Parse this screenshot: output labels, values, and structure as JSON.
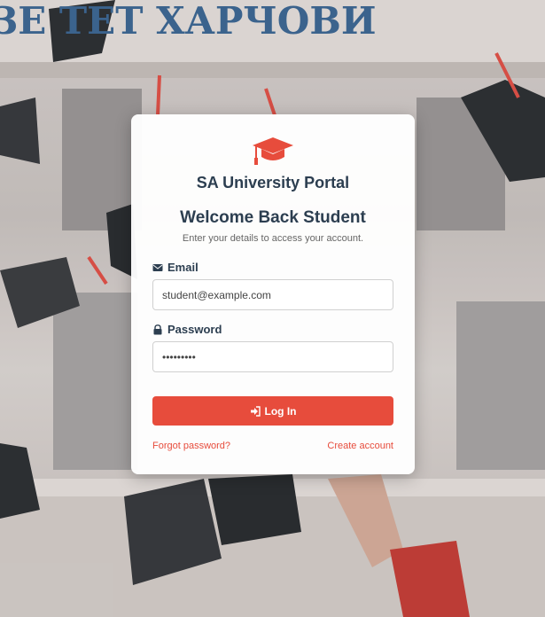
{
  "background": {
    "sign_text": "ЗЕ ТЕТ ХАРЧОВИ"
  },
  "brand": {
    "logo_icon": "graduation-cap-icon",
    "title": "SA University Portal",
    "accent": "#e74c3c",
    "text_color": "#2c3e50"
  },
  "form": {
    "heading": "Welcome Back Student",
    "subheading": "Enter your details to access your account.",
    "email": {
      "label": "Email",
      "icon": "envelope-icon",
      "value": "student@example.com"
    },
    "password": {
      "label": "Password",
      "icon": "lock-icon",
      "value": "•••••••••"
    },
    "submit": {
      "label": "Log In",
      "icon": "sign-in-icon"
    },
    "links": {
      "forgot": "Forgot password?",
      "create": "Create account"
    }
  }
}
